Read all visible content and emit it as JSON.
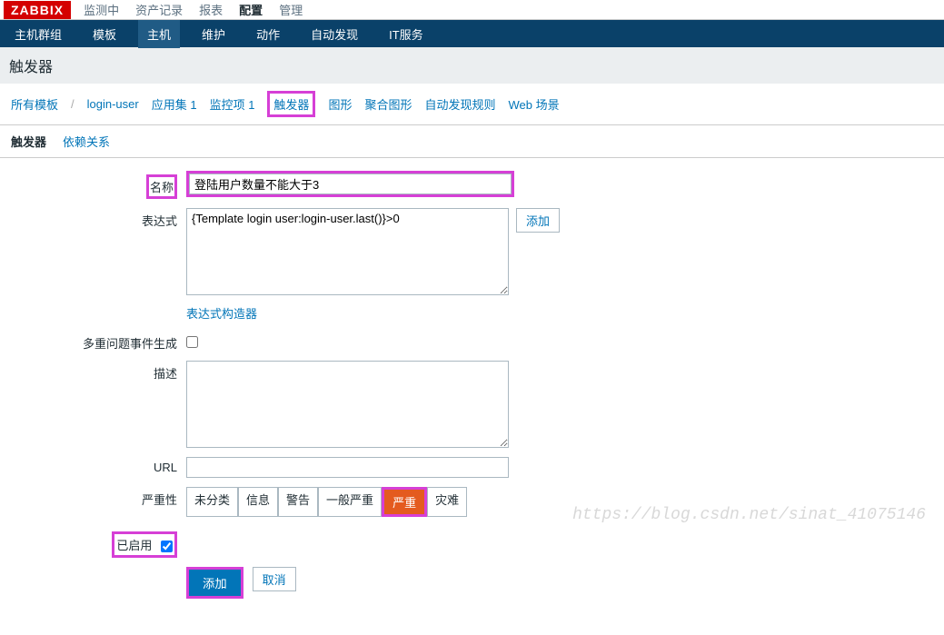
{
  "logo": "ZABBIX",
  "topmenu": {
    "items": [
      "监测中",
      "资产记录",
      "报表",
      "配置",
      "管理"
    ],
    "active": 3
  },
  "navbar": {
    "items": [
      "主机群组",
      "模板",
      "主机",
      "维护",
      "动作",
      "自动发现",
      "IT服务"
    ],
    "active": 2
  },
  "page_title": "触发器",
  "breadcrumb": {
    "all_templates": "所有模板",
    "sep": "/",
    "login_user": "login-user",
    "app_sets": "应用集 1",
    "items": "监控项 1",
    "triggers": "触发器",
    "graphs": "图形",
    "agg_graphs": "聚合图形",
    "discovery": "自动发现规则",
    "web": "Web 场景"
  },
  "subtabs": {
    "trigger": "触发器",
    "dependency": "依赖关系"
  },
  "form": {
    "name_label": "名称",
    "name_value": "登陆用户数量不能大于3",
    "expr_label": "表达式",
    "expr_value": "{Template login user:login-user.last()}>0",
    "add_btn": "添加",
    "expr_builder": "表达式构造器",
    "multi_label": "多重问题事件生成",
    "desc_label": "描述",
    "url_label": "URL",
    "url_value": "",
    "severity_label": "严重性",
    "severities": [
      "未分类",
      "信息",
      "警告",
      "一般严重",
      "严重",
      "灾难"
    ],
    "severity_selected": 4,
    "enabled_label": "已启用",
    "submit": "添加",
    "cancel": "取消"
  },
  "watermark": "https://blog.csdn.net/sinat_41075146"
}
